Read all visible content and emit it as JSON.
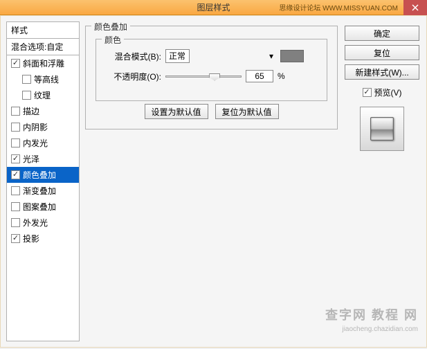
{
  "titlebar": {
    "title": "图层样式",
    "branding": "思缘设计论坛  WWW.MISSYUAN.COM"
  },
  "styles_panel": {
    "header": "样式",
    "blend_options": "混合选项:自定",
    "items": [
      {
        "label": "斜面和浮雕",
        "checked": true,
        "indent": false
      },
      {
        "label": "等高线",
        "checked": false,
        "indent": true
      },
      {
        "label": "纹理",
        "checked": false,
        "indent": true
      },
      {
        "label": "描边",
        "checked": false,
        "indent": false
      },
      {
        "label": "内阴影",
        "checked": false,
        "indent": false
      },
      {
        "label": "内发光",
        "checked": false,
        "indent": false
      },
      {
        "label": "光泽",
        "checked": true,
        "indent": false
      },
      {
        "label": "颜色叠加",
        "checked": true,
        "indent": false,
        "selected": true
      },
      {
        "label": "渐变叠加",
        "checked": false,
        "indent": false
      },
      {
        "label": "图案叠加",
        "checked": false,
        "indent": false
      },
      {
        "label": "外发光",
        "checked": false,
        "indent": false
      },
      {
        "label": "投影",
        "checked": true,
        "indent": false
      }
    ]
  },
  "settings": {
    "group_title": "颜色叠加",
    "sub_title": "颜色",
    "blend_mode_label": "混合模式(B):",
    "blend_mode_value": "正常",
    "opacity_label": "不透明度(O):",
    "opacity_value": "65",
    "opacity_unit": "%",
    "color_hex": "#808080",
    "btn_default": "设置为默认值",
    "btn_reset": "复位为默认值"
  },
  "right": {
    "ok": "确定",
    "cancel": "复位",
    "new_style": "新建样式(W)...",
    "preview_label": "预览(V)",
    "preview_checked": true
  },
  "watermark": {
    "line1": "查字网 教程 网",
    "line2": "jiaocheng.chazidian.com"
  }
}
